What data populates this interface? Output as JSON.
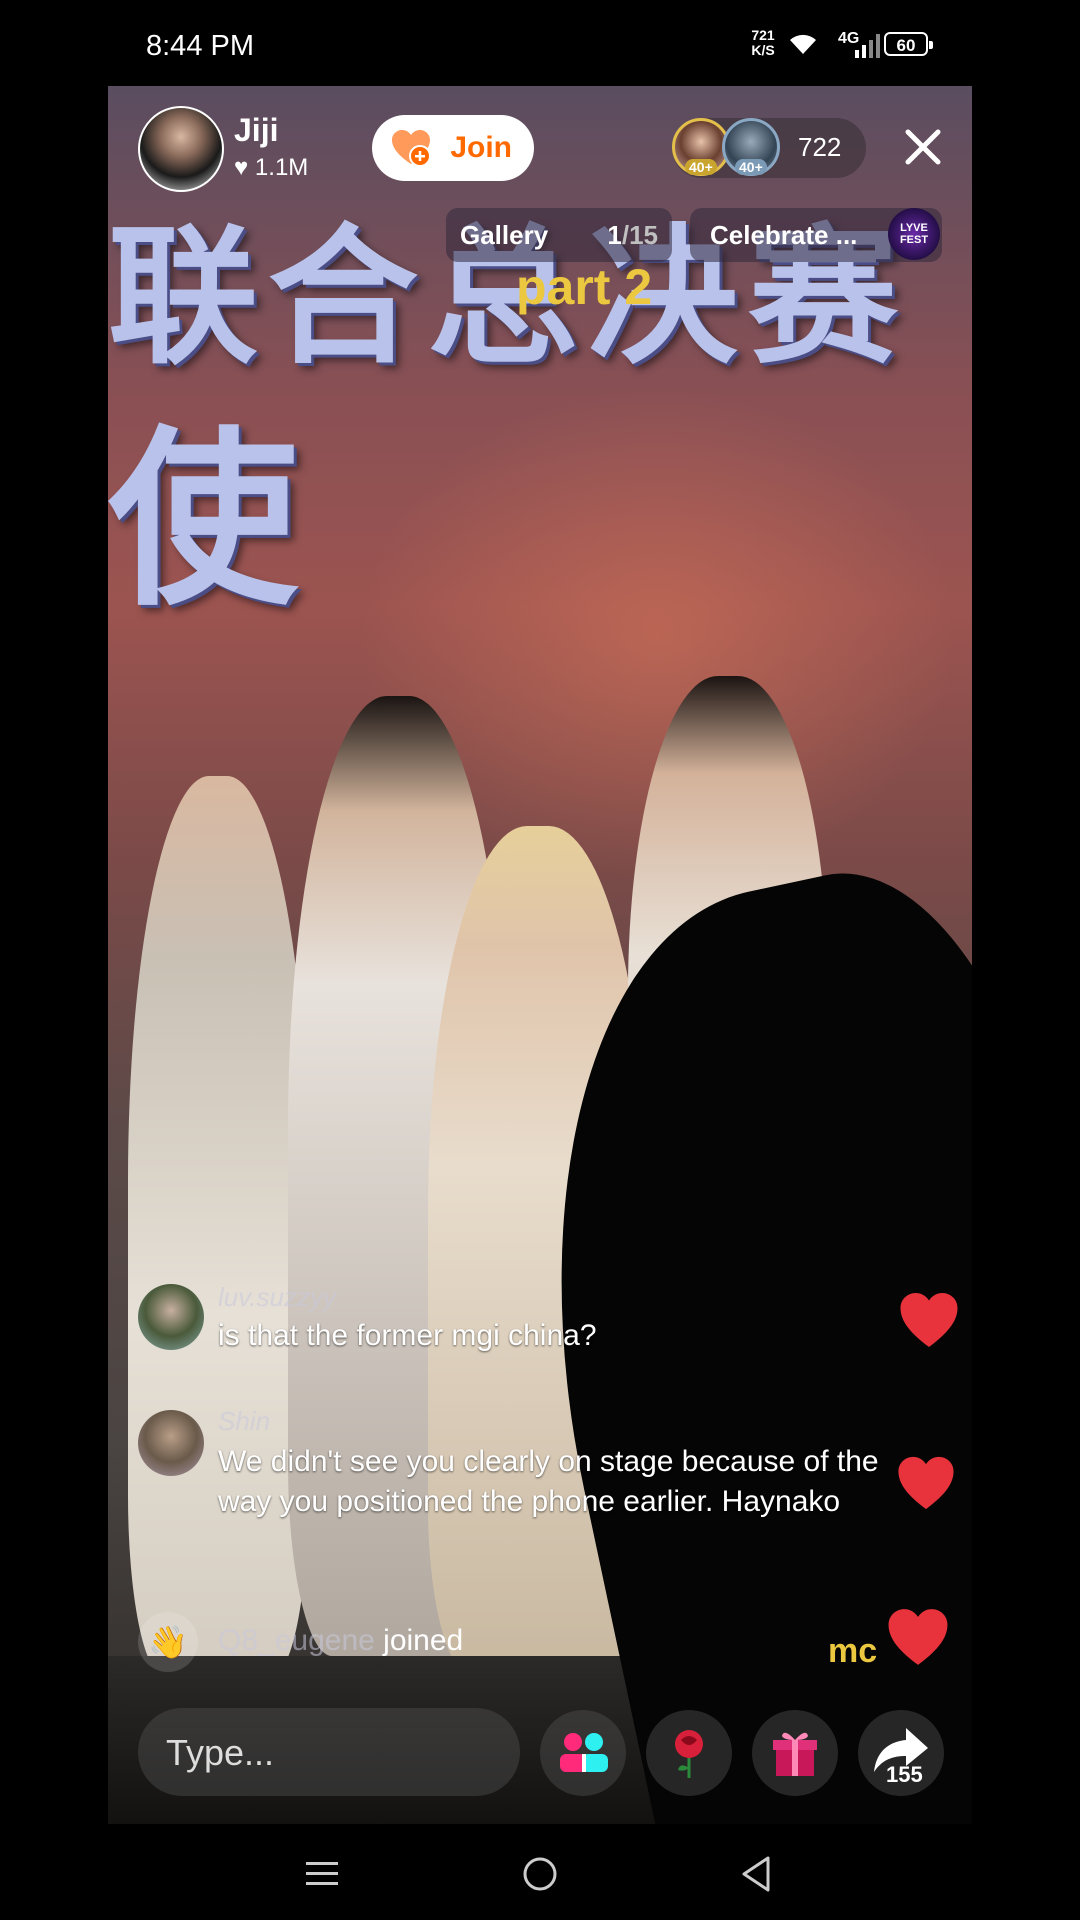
{
  "status_bar": {
    "time": "8:44 PM",
    "net_speed_value": "721",
    "net_speed_unit": "K/S",
    "network": "4G",
    "battery": "60"
  },
  "host": {
    "name": "Jiji",
    "likes": "1.1M",
    "join_label": "Join"
  },
  "viewers": {
    "avatars": [
      {
        "level": "40+"
      },
      {
        "level": "40+"
      }
    ],
    "count": "722"
  },
  "chips": {
    "gallery_label": "Gallery",
    "gallery_index": "1",
    "gallery_total": "/15",
    "celebrate_label": "Celebrate ...",
    "lyve_line1": "LYVE",
    "lyve_line2": "FEST"
  },
  "overlay": {
    "part_label": "part 2",
    "mc_label": "mc"
  },
  "comments": [
    {
      "user": "luv.suzzyy",
      "text": "is that the former mgi china?"
    },
    {
      "user": "Shin",
      "text": "We didn't see you clearly on stage because of the way you positioned the phone earlier. Haynako"
    }
  ],
  "joined": {
    "user": "Q8_eugene",
    "suffix": " joined"
  },
  "bottom": {
    "type_placeholder": "Type...",
    "share_count": "155"
  },
  "colors": {
    "join_text": "#ff6a00",
    "part_label": "#ecc840",
    "heart": "#e8323c"
  }
}
